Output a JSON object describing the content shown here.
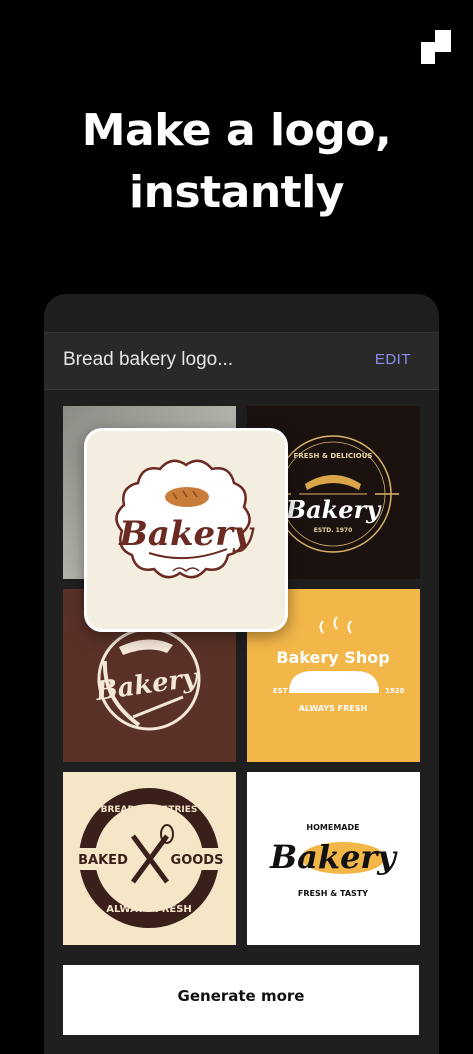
{
  "headline": {
    "line1": "Make a logo,",
    "line2": "instantly"
  },
  "prompt": {
    "text": "Bread bakery logo...",
    "edit_label": "EDIT"
  },
  "logos": {
    "featured": {
      "word": "Bakery"
    },
    "vintage": {
      "arc_text": "FRESH & DELICIOUS",
      "word": "Bakery",
      "est": "ESTD. 1970"
    },
    "wheat": {
      "word": "Bakery"
    },
    "shop": {
      "word": "Bakery Shop",
      "est": "EST",
      "year": "1920",
      "tagline": "ALWAYS FRESH"
    },
    "baked_goods": {
      "top": "BREAD & PASTRIES",
      "left": "BAKED",
      "right": "GOODS",
      "bottom": "ALWAYS FRESH"
    },
    "homemade": {
      "top": "HOMEMADE",
      "word": "Bakery",
      "tagline": "FRESH & TASTY"
    }
  },
  "button": {
    "generate_label": "Generate more"
  },
  "colors": {
    "background": "#000000",
    "accent": "#8a8ff0",
    "brown": "#6b2a22",
    "gold": "#f3b649"
  }
}
